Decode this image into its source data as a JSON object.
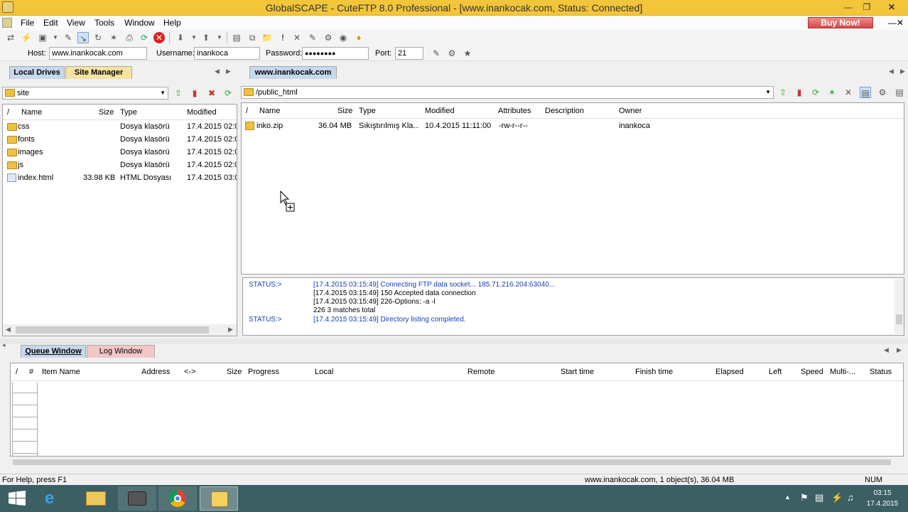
{
  "window": {
    "title": "GlobalSCAPE - CuteFTP 8.0 Professional - [www.inankocak.com, Status: Connected]",
    "buy_now": "Buy Now!"
  },
  "menu": [
    "File",
    "Edit",
    "View",
    "Tools",
    "Window",
    "Help"
  ],
  "connection": {
    "host_label": "Host:",
    "host": "www.inankocak.com",
    "username_label": "Username:",
    "username": "inankoca",
    "password_label": "Password:",
    "password": "●●●●●●●●",
    "port_label": "Port:",
    "port": "21"
  },
  "left_tabs": {
    "local": "Local Drives",
    "site_manager": "Site Manager"
  },
  "left_path": "site",
  "local_columns": {
    "slash": "/",
    "name": "Name",
    "size": "Size",
    "type": "Type",
    "modified": "Modified"
  },
  "local_files": [
    {
      "name": "css",
      "size": "",
      "type": "Dosya klasörü",
      "modified": "17.4.2015 02:0"
    },
    {
      "name": "fonts",
      "size": "",
      "type": "Dosya klasörü",
      "modified": "17.4.2015 02:0"
    },
    {
      "name": "images",
      "size": "",
      "type": "Dosya klasörü",
      "modified": "17.4.2015 02:0"
    },
    {
      "name": "js",
      "size": "",
      "type": "Dosya klasörü",
      "modified": "17.4.2015 02:0"
    },
    {
      "name": "index.html",
      "size": "33.98 KB",
      "type": "HTML Dosyası",
      "modified": "17.4.2015 03:0"
    }
  ],
  "remote_tab": "www.inankocak.com",
  "remote_path": "/public_html",
  "remote_columns": {
    "slash": "/",
    "name": "Name",
    "size": "Size",
    "type": "Type",
    "modified": "Modified",
    "attributes": "Attributes",
    "description": "Description",
    "owner": "Owner"
  },
  "remote_files": [
    {
      "name": "inko.zip",
      "size": "36.04 MB",
      "type": "Sıkıştırılmış Kla...",
      "modified": "10.4.2015 11:11:00",
      "attributes": "-rw-r--r--",
      "description": "",
      "owner": "inankoca"
    }
  ],
  "log": [
    {
      "status": "STATUS:>",
      "text": "[17.4.2015 03:15:49] Connecting FTP data socket... 185.71.216.204:63040...",
      "blue": true
    },
    {
      "status": "",
      "text": "[17.4.2015 03:15:49] 150 Accepted data connection",
      "blue": false
    },
    {
      "status": "",
      "text": "[17.4.2015 03:15:49] 226-Options: -a -l",
      "blue": false
    },
    {
      "status": "",
      "text": "226 3 matches total",
      "blue": false
    },
    {
      "status": "STATUS:>",
      "text": "[17.4.2015 03:15:49] Directory listing completed.",
      "blue": true
    }
  ],
  "bottom_tabs": {
    "queue": "Queue Window",
    "log": "Log Window"
  },
  "queue_columns": [
    "/",
    "#",
    "Item Name",
    "Address",
    "<->",
    "Size",
    "Progress",
    "Local",
    "Remote",
    "Start time",
    "Finish time",
    "Elapsed",
    "Left",
    "Speed",
    "Multi-...",
    "Status"
  ],
  "statusbar": {
    "help": "For Help, press F1",
    "summary": "www.inankocak.com, 1 object(s), 36.04 MB",
    "num": "NUM"
  },
  "clock": {
    "time": "03:15",
    "date": "17.4.2015"
  },
  "colors": {
    "title_bar": "#f3c53a",
    "taskbar": "#3b5f63",
    "status_blue": "#1a3fb0"
  }
}
